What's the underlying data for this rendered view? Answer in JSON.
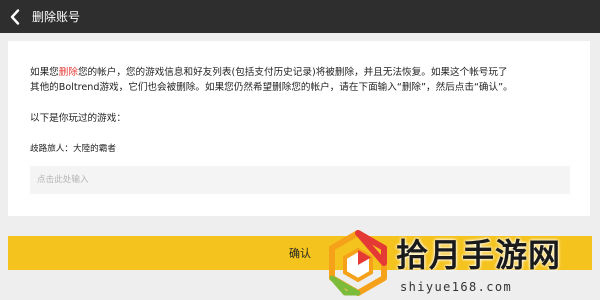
{
  "header": {
    "back_icon": "chevron-left-icon",
    "title": "删除账号"
  },
  "colors": {
    "topbar": "#2e2e2e",
    "warning_red": "#e53935",
    "confirm_yellow": "#f5c31d",
    "background": "#eeeeee"
  },
  "main": {
    "description": {
      "prefix": "如果您",
      "highlight": "删除",
      "line1_rest": "您的帐户，您的游戏信息和好友列表(包括支付历史记录)将被删除，并且无法恢复。如果这个帐号玩了",
      "line2": "其他的Boltrend游戏，它们也会被删除。如果您仍然希望删除您的帐户，请在下面输入“删除”，然后点击“确认”。"
    },
    "games_heading": "以下是你玩过的游戏：",
    "games": [
      "歧路旅人：大陸的霸者"
    ],
    "input_placeholder": "点击此处输入",
    "input_value": ""
  },
  "confirm_button": "确认",
  "watermark": {
    "title": "拾月手游网",
    "url": "shiyue168.com"
  }
}
